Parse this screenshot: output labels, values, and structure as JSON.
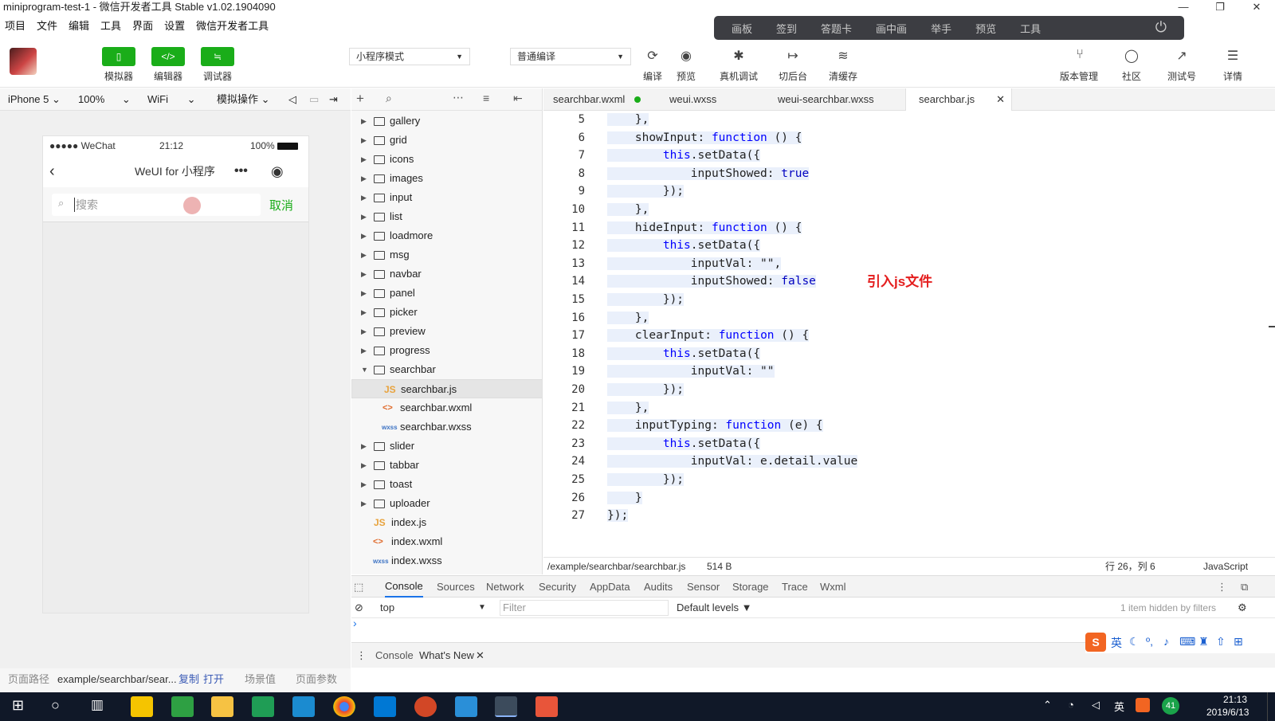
{
  "window": {
    "title": "miniprogram-test-1 - 微信开发者工具 Stable v1.02.1904090",
    "controls": [
      "—",
      "❐",
      "✕"
    ]
  },
  "menu": [
    "项目",
    "文件",
    "编辑",
    "工具",
    "界面",
    "设置",
    "微信开发者工具"
  ],
  "float_toolbar": {
    "items": [
      "画板",
      "签到",
      "答题卡",
      "画中画",
      "举手",
      "预览",
      "工具"
    ],
    "power_icon": "⏻"
  },
  "toolbar": {
    "simulator": "模拟器",
    "editor": "编辑器",
    "debugger": "调试器",
    "mode_select": "小程序模式",
    "compile_select": "普通编译",
    "compile": "编译",
    "preview": "预览",
    "remote_debug": "真机调试",
    "background": "切后台",
    "clear_cache": "清缓存",
    "version": "版本管理",
    "community": "社区",
    "test_account": "测试号",
    "details": "详情"
  },
  "sim_bar": {
    "device": "iPhone 5",
    "zoom": "100%",
    "network": "WiFi",
    "operation": "模拟操作"
  },
  "phone": {
    "carrier": "●●●●● WeChat",
    "time": "21:12",
    "battery": "100%",
    "nav_title": "WeUI for 小程序",
    "search_placeholder": "搜索",
    "cancel": "取消"
  },
  "footer_left": {
    "path_label": "页面路径",
    "path": "example/searchbar/sear...",
    "copy": "复制",
    "open": "打开",
    "scene": "场景值",
    "params": "页面参数"
  },
  "tree": {
    "folders_top": [
      "gallery",
      "grid",
      "icons",
      "images",
      "input",
      "list",
      "loadmore",
      "msg",
      "navbar",
      "panel",
      "picker",
      "preview",
      "progress"
    ],
    "open_folder": "searchbar",
    "open_files": [
      "searchbar.js",
      "searchbar.wxml",
      "searchbar.wxss"
    ],
    "folders_bottom": [
      "slider",
      "tabbar",
      "toast",
      "uploader"
    ],
    "root_files": [
      "index.js",
      "index.wxml",
      "index.wxss"
    ]
  },
  "tabs": [
    {
      "label": "searchbar.wxml",
      "dot": true
    },
    {
      "label": "weui.wxss"
    },
    {
      "label": "weui-searchbar.wxss"
    },
    {
      "label": "searchbar.js",
      "active": true,
      "close": "✕"
    }
  ],
  "code_lines": [
    {
      "n": "5",
      "t": "    },"
    },
    {
      "n": "6",
      "t": "    showInput: function () {"
    },
    {
      "n": "7",
      "t": "        this.setData({"
    },
    {
      "n": "8",
      "t": "            inputShowed: true"
    },
    {
      "n": "9",
      "t": "        });"
    },
    {
      "n": "10",
      "t": "    },"
    },
    {
      "n": "11",
      "t": "    hideInput: function () {"
    },
    {
      "n": "12",
      "t": "        this.setData({"
    },
    {
      "n": "13",
      "t": "            inputVal: \"\","
    },
    {
      "n": "14",
      "t": "            inputShowed: false"
    },
    {
      "n": "15",
      "t": "        });"
    },
    {
      "n": "16",
      "t": "    },"
    },
    {
      "n": "17",
      "t": "    clearInput: function () {"
    },
    {
      "n": "18",
      "t": "        this.setData({"
    },
    {
      "n": "19",
      "t": "            inputVal: \"\""
    },
    {
      "n": "20",
      "t": "        });"
    },
    {
      "n": "21",
      "t": "    },"
    },
    {
      "n": "22",
      "t": "    inputTyping: function (e) {"
    },
    {
      "n": "23",
      "t": "        this.setData({"
    },
    {
      "n": "24",
      "t": "            inputVal: e.detail.value"
    },
    {
      "n": "25",
      "t": "        });"
    },
    {
      "n": "26",
      "t": "    }"
    },
    {
      "n": "27",
      "t": "});"
    }
  ],
  "annotation": "引入js文件",
  "editor_status": {
    "path": "/example/searchbar/searchbar.js",
    "size": "514 B",
    "cursor": "行 26，列 6",
    "language": "JavaScript"
  },
  "devtools": {
    "tabs": [
      "Console",
      "Sources",
      "Network",
      "Security",
      "AppData",
      "Audits",
      "Sensor",
      "Storage",
      "Trace",
      "Wxml"
    ],
    "context": "top",
    "filter_placeholder": "Filter",
    "levels": "Default levels ▼",
    "hidden": "1 item hidden by filters",
    "prompt": "›",
    "drawer_tabs": [
      "Console",
      "What's New"
    ]
  },
  "ime": {
    "lang": "英"
  },
  "taskbar": {
    "lang": "英",
    "badge": "41",
    "time": "21:13",
    "date": "2019/6/13"
  },
  "colors": {
    "green": "#1aad19",
    "accent_red": "#e41e1e",
    "taskbar": "#101828"
  }
}
